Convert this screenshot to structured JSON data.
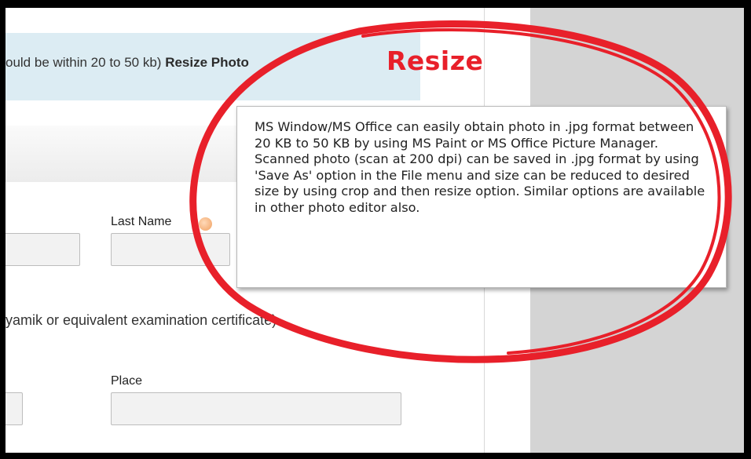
{
  "banner": {
    "text": "ould be within 20 to 50 kb)",
    "link_label": "Resize Photo"
  },
  "annotation": {
    "word": "Resize",
    "color": "#e8202a"
  },
  "form": {
    "last_name_label": "Last Name",
    "section_text": "yamik or equivalent examination certificate)",
    "place_label": "Place"
  },
  "tooltip": {
    "text": "MS Window/MS Office can easily obtain photo in .jpg format between 20 KB to 50 KB by using MS Paint or MS Office Picture Manager. Scanned photo (scan at 200 dpi) can be saved in .jpg format by using 'Save As' option in the File menu and size can be reduced to desired size by using crop and then resize option. Similar options are available in other photo editor also."
  },
  "icons": {
    "info": "info-icon"
  }
}
